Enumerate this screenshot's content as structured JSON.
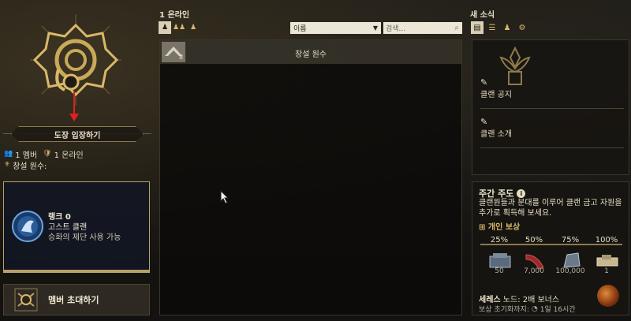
{
  "left": {
    "enter_button": "도장 입장하기",
    "members_count": "1 멤버",
    "online_count": "1 온라인",
    "founder_label": "창설 원수:",
    "rank": {
      "title": "랭크 0",
      "clan_type": "고스트 클랜",
      "description": "승화의 제단 사용 가능"
    },
    "invite_button": "멤버 초대하기"
  },
  "middle": {
    "online_title": "1 온라인",
    "sort": {
      "selected": "이름"
    },
    "search": {
      "placeholder": "검색..."
    },
    "members": [
      {
        "rank_number": "8",
        "role": "창설 원수"
      }
    ]
  },
  "right": {
    "news_title": "새 소식",
    "news_items": [
      {
        "label": "클랜 공지"
      },
      {
        "label": "클랜 소개"
      }
    ],
    "weekly": {
      "title": "주간 주도",
      "description": "클랜원들과 분대를 이루어 클랜 금고 자원을 추가로 획득해 보세요.",
      "personal_reward": "개인 보상",
      "tiers": [
        {
          "percent": "25%",
          "value": "50"
        },
        {
          "percent": "50%",
          "value": "7,000"
        },
        {
          "percent": "75%",
          "value": "100,000"
        },
        {
          "percent": "100%",
          "value": "1"
        }
      ],
      "bonus_title": "세레스",
      "bonus_rest": " 노드: 2배 보너스",
      "reset_label": "보상 초기화까지:",
      "reset_time": "1일 16시간"
    }
  },
  "colors": {
    "accent_gold": "#d9b86a",
    "arrow_red": "#e02020"
  }
}
